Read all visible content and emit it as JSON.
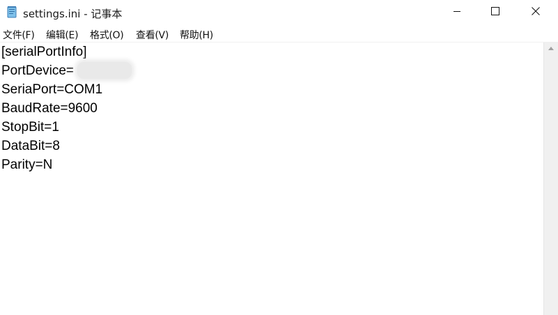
{
  "window": {
    "title": "settings.ini - 记事本",
    "icon": "notepad-icon"
  },
  "controls": {
    "minimize_icon": "minimize-icon",
    "maximize_icon": "maximize-icon",
    "close_icon": "close-icon"
  },
  "menu": {
    "items": [
      {
        "label": "文件(F)"
      },
      {
        "label": "编辑(E)"
      },
      {
        "label": "格式(O)"
      },
      {
        "label": "查看(V)"
      },
      {
        "label": "帮助(H)"
      }
    ]
  },
  "editor": {
    "lines": [
      "[serialPortInfo]",
      "PortDevice=",
      "SeriaPort=COM1",
      "BaudRate=9600",
      "StopBit=1",
      "DataBit=8",
      "Parity=N"
    ]
  }
}
